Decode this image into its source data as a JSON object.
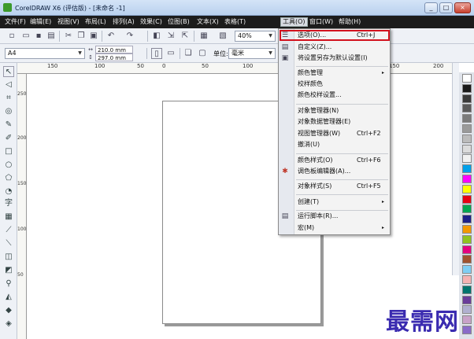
{
  "window": {
    "title": "CorelDRAW X6 (评估版) - [未命名 -1]",
    "controls": [
      "_",
      "□",
      "×"
    ]
  },
  "menubar": {
    "items": [
      {
        "label": "文件(F)",
        "active": false
      },
      {
        "label": "编辑(E)",
        "active": false
      },
      {
        "label": "视图(V)",
        "active": false
      },
      {
        "label": "布局(L)",
        "active": false
      },
      {
        "label": "排列(A)",
        "active": false
      },
      {
        "label": "效果(C)",
        "active": false
      },
      {
        "label": "位图(B)",
        "active": false
      },
      {
        "label": "文本(X)",
        "active": false
      },
      {
        "label": "表格(T)",
        "active": false
      },
      {
        "label": "工具(O)",
        "active": true
      },
      {
        "label": "窗口(W)",
        "active": false
      },
      {
        "label": "帮助(H)",
        "active": false
      }
    ]
  },
  "toolbar": {
    "zoom_value": "40%"
  },
  "property_bar": {
    "paper_size": "A4",
    "width": "210.0 mm",
    "height": "297.0 mm",
    "units_label": "单位:",
    "units_value": "毫米"
  },
  "ruler": {
    "h_ticks": [
      "150",
      "100",
      "50",
      "0",
      "50",
      "100",
      "150",
      "200"
    ],
    "v_ticks": [
      "250",
      "200",
      "150",
      "100",
      "50"
    ]
  },
  "tools_menu": {
    "items": [
      {
        "label": "选项(O)...",
        "shortcut": "Ctrl+J",
        "icon": "options-icon"
      },
      {
        "label": "自定义(Z)...",
        "shortcut": "",
        "icon": "customize-icon"
      },
      {
        "label": "将设置另存为默认设置(I)",
        "shortcut": "",
        "icon": "save-defaults-icon"
      },
      {
        "label": "颜色管理",
        "shortcut": "",
        "icon": "",
        "submenu": "▸"
      },
      {
        "label": "校样颜色",
        "shortcut": "",
        "icon": ""
      },
      {
        "label": "颜色校样设置...",
        "shortcut": "",
        "icon": ""
      },
      {
        "label": "对象管理器(N)",
        "shortcut": "",
        "icon": ""
      },
      {
        "label": "对象数据管理器(E)",
        "shortcut": "",
        "icon": ""
      },
      {
        "label": "视图管理器(W)",
        "shortcut": "Ctrl+F2",
        "icon": ""
      },
      {
        "label": "撤消(U)",
        "shortcut": "",
        "icon": ""
      },
      {
        "label": "颜色样式(O)",
        "shortcut": "Ctrl+F6",
        "icon": ""
      },
      {
        "label": "调色板编辑器(A)...",
        "shortcut": "",
        "icon": "palette-editor-icon"
      },
      {
        "label": "对象样式(S)",
        "shortcut": "Ctrl+F5",
        "icon": ""
      },
      {
        "label": "创建(T)",
        "shortcut": "",
        "icon": "",
        "submenu": "▸"
      },
      {
        "label": "运行脚本(R)...",
        "shortcut": "",
        "icon": "run-script-icon"
      },
      {
        "label": "宏(M)",
        "shortcut": "",
        "icon": "",
        "submenu": "▸"
      }
    ]
  },
  "palette": {
    "colors": [
      "#ffffff",
      "#1a1a1a",
      "#3a3a3a",
      "#5a5a5a",
      "#7a7a7a",
      "#9a9a9a",
      "#bcbcbc",
      "#dcdcdc",
      "#f2f2f2",
      "#00a0e9",
      "#ff00ff",
      "#ffff00",
      "#e60012",
      "#00a651",
      "#1d2088",
      "#f39800",
      "#8fc31f",
      "#e4007f",
      "#a0522d",
      "#7ecef4",
      "#f5b2b2",
      "#00736d",
      "#6a3d9a",
      "#b0b0d0",
      "#c8a2c8",
      "#8a6cc8"
    ]
  },
  "watermark": {
    "text": "最需网"
  }
}
